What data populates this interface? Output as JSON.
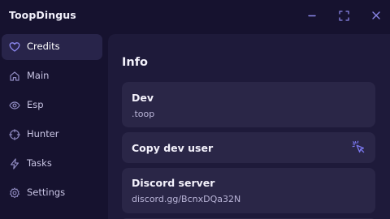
{
  "app": {
    "title": "ToopDingus"
  },
  "window_controls": {
    "minimize_icon": "minus-icon",
    "maximize_icon": "maximize-corners-icon",
    "close_icon": "x-icon"
  },
  "sidebar": {
    "items": [
      {
        "label": "Credits",
        "icon": "heart-icon",
        "active": true
      },
      {
        "label": "Main",
        "icon": "home-icon",
        "active": false
      },
      {
        "label": "Esp",
        "icon": "eye-icon",
        "active": false
      },
      {
        "label": "Hunter",
        "icon": "crosshair-icon",
        "active": false
      },
      {
        "label": "Tasks",
        "icon": "lightning-icon",
        "active": false
      },
      {
        "label": "Settings",
        "icon": "gear-icon",
        "active": false
      }
    ]
  },
  "main": {
    "section_title": "Info",
    "cards": {
      "dev": {
        "title": "Dev",
        "value": ".toop"
      },
      "copy": {
        "title": "Copy dev user",
        "icon": "pointer-click-icon"
      },
      "discord": {
        "title": "Discord server",
        "value": "discord.gg/BcnxDQa32N"
      }
    }
  },
  "colors": {
    "background": "#16122f",
    "panel": "#1e1a3a",
    "card": "#2a2647",
    "active_nav": "#28244a",
    "accent": "#7b78f0",
    "icon_muted": "#9a95c9"
  }
}
